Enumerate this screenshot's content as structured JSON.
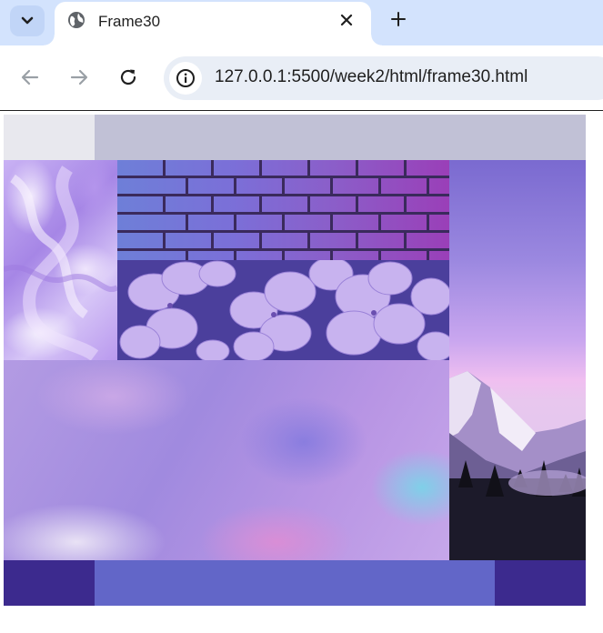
{
  "browser": {
    "tab": {
      "title": "Frame30"
    },
    "address_bar": {
      "url": "127.0.0.1:5500/week2/html/frame30.html"
    }
  },
  "page": {
    "colors": {
      "top_left": "#e8e8ee",
      "top_bar": "#c1c1d6",
      "bottom_left": "#3c2a8e",
      "bottom_middle": "#6266c8",
      "bottom_right": "#3c2a8e"
    },
    "images": [
      "purple-smoke",
      "purple-brick-wall",
      "hydrangea-flowers",
      "purple-mountain",
      "purple-watercolor"
    ]
  }
}
